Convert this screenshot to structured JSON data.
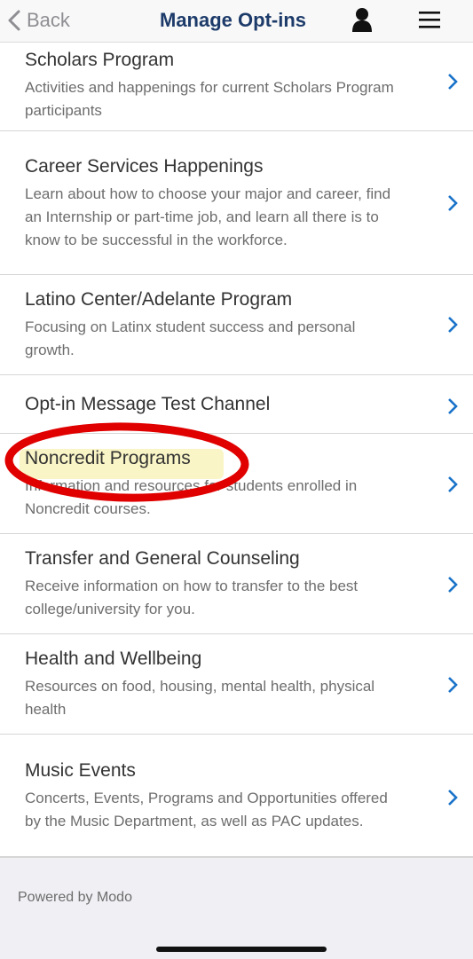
{
  "header": {
    "back_label": "Back",
    "title": "Manage Opt-ins",
    "icons": [
      "chevron-left-icon",
      "person-icon",
      "menu-icon"
    ]
  },
  "items": [
    {
      "title": "Scholars Program",
      "desc": "Activities and happenings for current Scholars Program participants"
    },
    {
      "title": "Career Services Happenings",
      "desc": "Learn about how to choose your major and career, find an Internship or part-time job, and learn all there is to know to be successful in the workforce."
    },
    {
      "title": "Latino Center/Adelante Program",
      "desc": "Focusing on Latinx student success and personal growth."
    },
    {
      "title": "Opt-in Message Test Channel",
      "desc": ""
    },
    {
      "title": "Noncredit Programs",
      "desc": "Information and resources for students enrolled in Noncredit courses."
    },
    {
      "title": "Transfer and General Counseling",
      "desc": "Receive information on how to transfer to the best college/university for you."
    },
    {
      "title": "Health and Wellbeing",
      "desc": "Resources on food, housing, mental health, physical health"
    },
    {
      "title": "Music Events",
      "desc": "Concerts, Events, Programs and Opportunities offered by the Music Department, as well as PAC updates."
    }
  ],
  "footer": {
    "powered_by": "Powered by Modo"
  },
  "colors": {
    "title": "#1d3b6a",
    "chevron": "#1a73c9",
    "annotation": "#e00000",
    "highlight": "#f9f2b8"
  }
}
